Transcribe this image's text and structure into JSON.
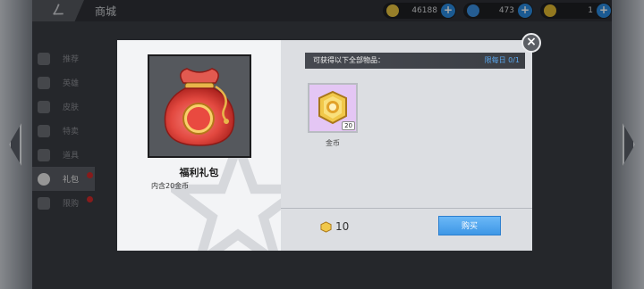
{
  "topbar": {
    "title": "商城",
    "currencies": [
      {
        "icon": "gold-coin-icon",
        "value": "46188",
        "color": "#e8c440"
      },
      {
        "icon": "diamond-icon",
        "value": "473",
        "color": "#3a8fe0"
      },
      {
        "icon": "ticket-icon",
        "value": "1",
        "color": "#e0b830"
      }
    ]
  },
  "side_menu": {
    "items": [
      {
        "label": "推荐"
      },
      {
        "label": "英雄"
      },
      {
        "label": "皮肤"
      },
      {
        "label": "特卖"
      },
      {
        "label": "道具"
      },
      {
        "label": "礼包"
      },
      {
        "label": "限购"
      }
    ]
  },
  "modal": {
    "item_name": "福利礼包",
    "item_desc": "内含20金币",
    "list_header": "可获得以下全部物品：",
    "limit": "限每日 0/1",
    "rewards": [
      {
        "name": "金币",
        "count": "20",
        "icon": "gold-coin-icon"
      }
    ],
    "price": "10",
    "buy_label": "购买",
    "close_label": "×"
  }
}
